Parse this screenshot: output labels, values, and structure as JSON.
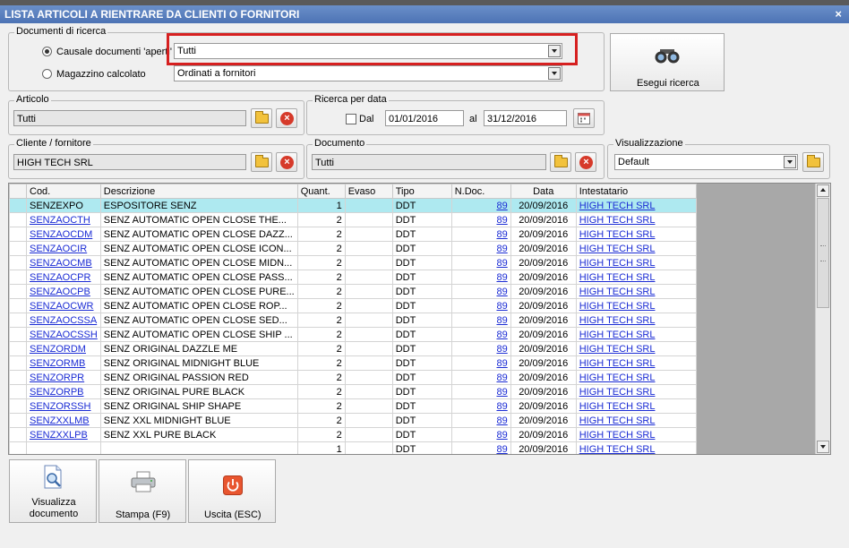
{
  "window": {
    "title": "LISTA ARTICOLI A RIENTRARE DA CLIENTI O FORNITORI",
    "close_glyph": "×"
  },
  "search_docs": {
    "legend": "Documenti di ricerca",
    "radio1_label": "Causale documenti 'aperti'",
    "radio1_value": "Tutti",
    "radio2_label": "Magazzino calcolato",
    "radio2_value": "Ordinati a fornitori"
  },
  "search_button": {
    "label": "Esegui ricerca",
    "icon": "binoculars-icon"
  },
  "articolo": {
    "legend": "Articolo",
    "value": "Tutti"
  },
  "ricerca_data": {
    "legend": "Ricerca per data",
    "dal_label": "Dal",
    "from": "01/01/2016",
    "al_label": "al",
    "to": "31/12/2016"
  },
  "cliente": {
    "legend": "Cliente / fornitore",
    "value": "HIGH TECH SRL"
  },
  "documento": {
    "legend": "Documento",
    "value": "Tutti"
  },
  "visualizzazione": {
    "legend": "Visualizzazione",
    "value": "Default"
  },
  "grid": {
    "headers": [
      "Cod.",
      "Descrizione",
      "Quant.",
      "Evaso",
      "Tipo",
      "N.Doc.",
      "Data",
      "Intestatario"
    ],
    "rows": [
      {
        "cod": "SENZEXPO",
        "desc": "ESPOSITORE SENZ",
        "qty": "1",
        "evaso": "",
        "tipo": "DDT",
        "ndoc": "89",
        "data": "20/09/2016",
        "int": "HIGH TECH SRL"
      },
      {
        "cod": "SENZAOCTH",
        "desc": "SENZ AUTOMATIC OPEN CLOSE  THE...",
        "qty": "2",
        "evaso": "",
        "tipo": "DDT",
        "ndoc": "89",
        "data": "20/09/2016",
        "int": "HIGH TECH SRL"
      },
      {
        "cod": "SENZAOCDM",
        "desc": "SENZ AUTOMATIC OPEN CLOSE DAZZ...",
        "qty": "2",
        "evaso": "",
        "tipo": "DDT",
        "ndoc": "89",
        "data": "20/09/2016",
        "int": "HIGH TECH SRL"
      },
      {
        "cod": "SENZAOCIR",
        "desc": "SENZ AUTOMATIC OPEN CLOSE ICON...",
        "qty": "2",
        "evaso": "",
        "tipo": "DDT",
        "ndoc": "89",
        "data": "20/09/2016",
        "int": "HIGH TECH SRL"
      },
      {
        "cod": "SENZAOCMB",
        "desc": "SENZ AUTOMATIC OPEN CLOSE MIDN...",
        "qty": "2",
        "evaso": "",
        "tipo": "DDT",
        "ndoc": "89",
        "data": "20/09/2016",
        "int": "HIGH TECH SRL"
      },
      {
        "cod": "SENZAOCPR",
        "desc": "SENZ AUTOMATIC OPEN CLOSE PASS...",
        "qty": "2",
        "evaso": "",
        "tipo": "DDT",
        "ndoc": "89",
        "data": "20/09/2016",
        "int": "HIGH TECH SRL"
      },
      {
        "cod": "SENZAOCPB",
        "desc": "SENZ AUTOMATIC OPEN CLOSE PURE...",
        "qty": "2",
        "evaso": "",
        "tipo": "DDT",
        "ndoc": "89",
        "data": "20/09/2016",
        "int": "HIGH TECH SRL"
      },
      {
        "cod": "SENZAOCWR",
        "desc": "SENZ AUTOMATIC OPEN CLOSE ROP...",
        "qty": "2",
        "evaso": "",
        "tipo": "DDT",
        "ndoc": "89",
        "data": "20/09/2016",
        "int": "HIGH TECH SRL"
      },
      {
        "cod": "SENZAOCSSA",
        "desc": "SENZ AUTOMATIC OPEN CLOSE SED...",
        "qty": "2",
        "evaso": "",
        "tipo": "DDT",
        "ndoc": "89",
        "data": "20/09/2016",
        "int": "HIGH TECH SRL"
      },
      {
        "cod": "SENZAOCSSH",
        "desc": "SENZ AUTOMATIC OPEN CLOSE SHIP ...",
        "qty": "2",
        "evaso": "",
        "tipo": "DDT",
        "ndoc": "89",
        "data": "20/09/2016",
        "int": "HIGH TECH SRL"
      },
      {
        "cod": "SENZORDM",
        "desc": "SENZ ORIGINAL DAZZLE ME",
        "qty": "2",
        "evaso": "",
        "tipo": "DDT",
        "ndoc": "89",
        "data": "20/09/2016",
        "int": "HIGH TECH SRL"
      },
      {
        "cod": "SENZORMB",
        "desc": "SENZ ORIGINAL MIDNIGHT BLUE",
        "qty": "2",
        "evaso": "",
        "tipo": "DDT",
        "ndoc": "89",
        "data": "20/09/2016",
        "int": "HIGH TECH SRL"
      },
      {
        "cod": "SENZORPR",
        "desc": "SENZ ORIGINAL PASSION RED",
        "qty": "2",
        "evaso": "",
        "tipo": "DDT",
        "ndoc": "89",
        "data": "20/09/2016",
        "int": "HIGH TECH SRL"
      },
      {
        "cod": "SENZORPB",
        "desc": "SENZ ORIGINAL PURE BLACK",
        "qty": "2",
        "evaso": "",
        "tipo": "DDT",
        "ndoc": "89",
        "data": "20/09/2016",
        "int": "HIGH TECH SRL"
      },
      {
        "cod": "SENZORSSH",
        "desc": "SENZ ORIGINAL SHIP SHAPE",
        "qty": "2",
        "evaso": "",
        "tipo": "DDT",
        "ndoc": "89",
        "data": "20/09/2016",
        "int": "HIGH TECH SRL"
      },
      {
        "cod": "SENZXXLMB",
        "desc": "SENZ XXL MIDNIGHT BLUE",
        "qty": "2",
        "evaso": "",
        "tipo": "DDT",
        "ndoc": "89",
        "data": "20/09/2016",
        "int": "HIGH TECH SRL"
      },
      {
        "cod": "SENZXXLPB",
        "desc": "SENZ XXL PURE BLACK",
        "qty": "2",
        "evaso": "",
        "tipo": "DDT",
        "ndoc": "89",
        "data": "20/09/2016",
        "int": "HIGH TECH SRL"
      },
      {
        "cod": "",
        "desc": "",
        "qty": "1",
        "evaso": "",
        "tipo": "DDT",
        "ndoc": "89",
        "data": "20/09/2016",
        "int": "HIGH TECH SRL"
      }
    ]
  },
  "footer": {
    "view_doc_label": "Visualizza documento",
    "print_label": "Stampa (F9)",
    "exit_label": "Uscita (ESC)"
  },
  "colors": {
    "title_bar": "#5479bb",
    "selected_row": "#aee9f0",
    "link": "#1a2bd4",
    "highlight_box": "#d62020"
  }
}
